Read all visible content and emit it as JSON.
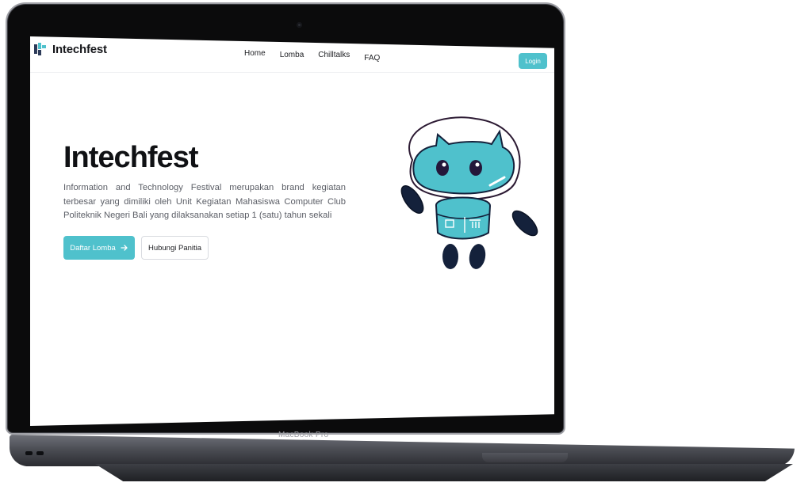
{
  "device": {
    "brand_label": "MacBook Pro"
  },
  "nav": {
    "logo_text": "Intechfest",
    "menu": [
      "Home",
      "Lomba",
      "Chilltalks",
      "FAQ"
    ],
    "login_label": "Login"
  },
  "hero": {
    "title": "Intechfest",
    "description": "Information and Technology Festival merupakan brand kegiatan terbesar yang dimiliki oleh Unit Kegiatan Mahasiswa Computer Club Politeknik Negeri Bali yang dilaksanakan setiap 1 (satu) tahun sekali",
    "primary_button": "Daftar Lomba",
    "primary_icon": "arrow-right-icon",
    "secondary_button": "Hubungi Panitia"
  },
  "colors": {
    "accent": "#4fc1cc",
    "mascot_body": "#4fc1cc",
    "dark": "#14213b"
  }
}
